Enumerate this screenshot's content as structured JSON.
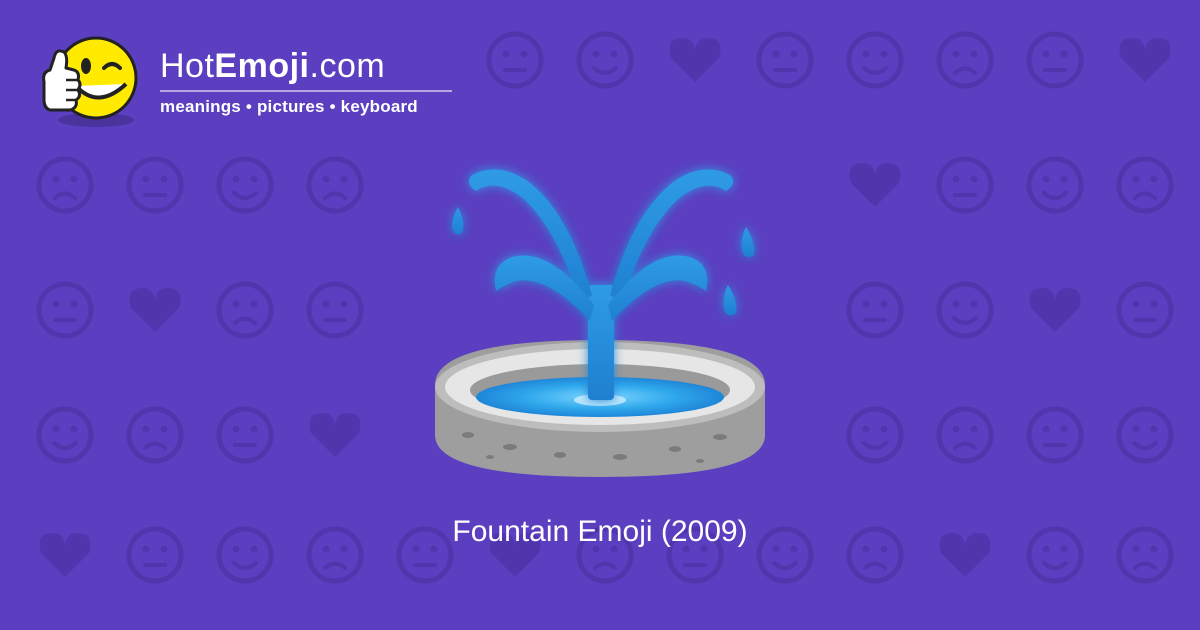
{
  "brand": {
    "name_light": "Hot",
    "name_bold": "Emoji",
    "name_suffix": ".com",
    "tagline": "meanings • pictures • keyboard"
  },
  "hero": {
    "icon": "fountain-icon",
    "caption": "Fountain Emoji (2009)"
  },
  "colors": {
    "background": "#5b3fc0",
    "pattern": "#5035ad",
    "water": "#2f9be6",
    "water_light": "#5fc3ff",
    "stone": "#9e9e9e"
  }
}
